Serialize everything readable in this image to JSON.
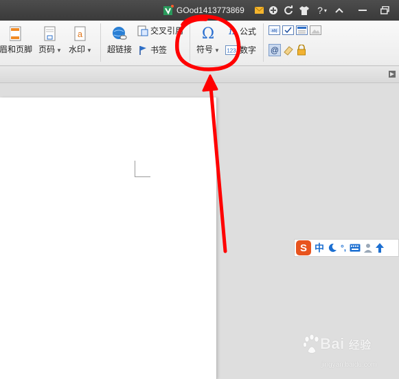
{
  "titlebar": {
    "username": "GOod1413773869",
    "icons": [
      "user-badge-icon",
      "mail-icon",
      "skin-icon",
      "refresh-icon",
      "shirt-icon",
      "help-icon",
      "collapse-icon",
      "minimize-icon",
      "restore-icon"
    ],
    "help_label": "?"
  },
  "ribbon": {
    "header_footer": "眉和页脚",
    "page_number": "页码",
    "watermark": "水印",
    "hyperlink": "超链接",
    "cross_ref": "交叉引用",
    "bookmark": "书签",
    "symbol": "符号",
    "formula": "公式",
    "number": "数字"
  },
  "ime": {
    "logo": "S",
    "mode": "中"
  },
  "watermark": {
    "brand": "Bai",
    "brand_suffix": "经验",
    "url": "jingyan.baidu.com"
  },
  "colors": {
    "annotation": "#ff0000",
    "titlebar": "#3f3f3f",
    "ime_logo": "#e8541e"
  }
}
